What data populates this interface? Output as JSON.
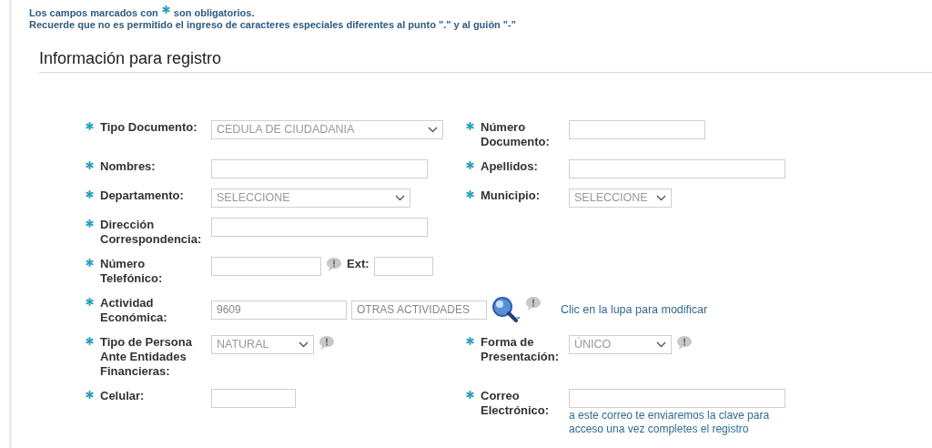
{
  "notice": {
    "before": "Los campos marcados con",
    "after": "son obligatorios.",
    "rule": "Recuerde que no es permitido el ingreso de caracteres especiales diferentes al punto \".\" y al guión \"-\""
  },
  "section_title": "Información para registro",
  "rows": [
    {
      "left": {
        "label": "Tipo Documento:",
        "required": true,
        "parts": [
          {
            "kind": "select",
            "value": "CEDULA DE CIUDADANIA"
          }
        ]
      },
      "right": {
        "label": "Número Documento:",
        "required": true,
        "parts": [
          {
            "kind": "input"
          }
        ]
      }
    },
    {
      "left": {
        "label": "Nombres:",
        "required": true,
        "parts": [
          {
            "kind": "input"
          }
        ]
      },
      "right": {
        "label": "Apellidos:",
        "required": true,
        "parts": [
          {
            "kind": "input"
          }
        ]
      }
    },
    {
      "left": {
        "label": "Departamento:",
        "required": true,
        "parts": [
          {
            "kind": "select",
            "value": "SELECCIONE"
          }
        ]
      },
      "right": {
        "label": "Municipio:",
        "required": true,
        "parts": [
          {
            "kind": "select",
            "value": "SELECCIONE"
          }
        ]
      }
    },
    {
      "left": {
        "label": "Dirección Correspondencia:",
        "required": true,
        "parts": [
          {
            "kind": "input"
          }
        ]
      }
    },
    {
      "left": {
        "label": "Número Telefónico:",
        "required": true,
        "parts": [
          {
            "kind": "input"
          },
          {
            "kind": "info"
          },
          {
            "kind": "label",
            "text": "Ext:"
          },
          {
            "kind": "input"
          }
        ]
      }
    },
    {
      "left": {
        "label": "Actividad Económica:",
        "required": true,
        "parts": [
          {
            "kind": "input",
            "value": "9609"
          },
          {
            "kind": "input",
            "value": "OTRAS ACTIVIDADES"
          },
          {
            "kind": "lookup"
          },
          {
            "kind": "info"
          },
          {
            "kind": "note",
            "text": "Clic en la lupa para modificar"
          }
        ]
      }
    },
    {
      "left": {
        "label": "Tipo de Persona Ante Entidades Financieras:",
        "required": true,
        "parts": [
          {
            "kind": "select",
            "value": "NATURAL"
          },
          {
            "kind": "info"
          }
        ]
      },
      "right": {
        "label": "Forma de Presentación:",
        "required": true,
        "parts": [
          {
            "kind": "select",
            "value": "ÚNICO"
          },
          {
            "kind": "info"
          }
        ]
      }
    },
    {
      "left": {
        "label": "Celular:",
        "required": true,
        "parts": [
          {
            "kind": "input"
          }
        ]
      },
      "right": {
        "label": "Correo Electrónico:",
        "required": true,
        "parts": [
          {
            "kind": "input"
          },
          {
            "kind": "hint",
            "text": "a este correo te enviaremos la clave para acceso una vez completes el registro"
          }
        ]
      }
    }
  ]
}
